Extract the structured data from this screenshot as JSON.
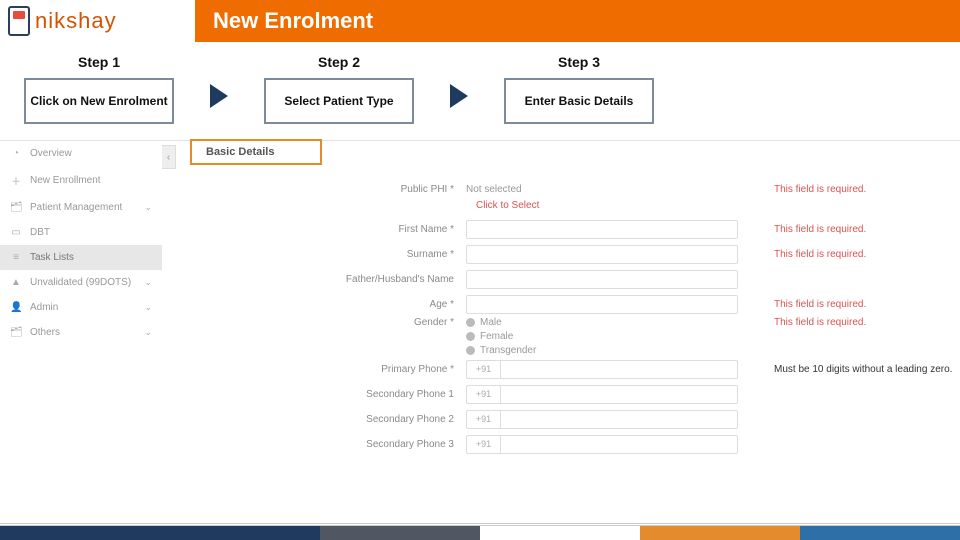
{
  "logo_text": "nikshay",
  "title": "New Enrolment",
  "steps": [
    {
      "label": "Step 1",
      "box": "Click on New Enrolment"
    },
    {
      "label": "Step 2",
      "box": "Select Patient Type"
    },
    {
      "label": "Step 3",
      "box": "Enter Basic Details"
    }
  ],
  "sidebar": [
    {
      "icon": "◔",
      "label": "Overview",
      "chev": ""
    },
    {
      "icon": "＋",
      "label": "New Enrollment",
      "chev": ""
    },
    {
      "icon": "🗂",
      "label": "Patient Management",
      "chev": "⌄"
    },
    {
      "icon": "▭",
      "label": "DBT",
      "chev": ""
    },
    {
      "icon": "≡",
      "label": "Task Lists",
      "chev": "",
      "active": true
    },
    {
      "icon": "▲",
      "label": "Unvalidated (99DOTS)",
      "chev": "⌄"
    },
    {
      "icon": "👤",
      "label": "Admin",
      "chev": "⌄"
    },
    {
      "icon": "🗂",
      "label": "Others",
      "chev": "⌄"
    }
  ],
  "tab": "Basic Details",
  "click_select": "Click to Select",
  "err_required": "This field is required.",
  "err_phone": "Must be 10 digits without a leading zero.",
  "labels": {
    "phi": "Public PHI *",
    "phi_val": "Not selected",
    "first": "First Name *",
    "surname": "Surname *",
    "father": "Father/Husband's Name",
    "age": "Age *",
    "gender": "Gender *",
    "male": "Male",
    "female": "Female",
    "trans": "Transgender",
    "p1": "Primary Phone *",
    "p2": "Secondary Phone 1",
    "p3": "Secondary Phone 2",
    "p4": "Secondary Phone 3",
    "cc": "+91"
  },
  "footer_colors": [
    "#1f3a5f",
    "#1f3a5f",
    "#505763",
    "#ffffff",
    "#e48b2e",
    "#2e6fa7"
  ]
}
